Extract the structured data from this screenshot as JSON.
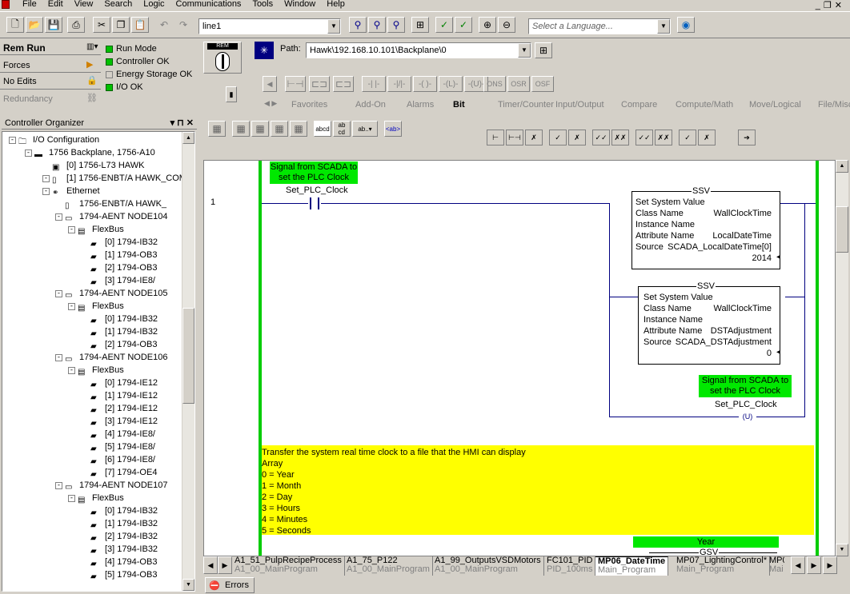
{
  "menu": [
    "File",
    "Edit",
    "View",
    "Search",
    "Logic",
    "Communications",
    "Tools",
    "Window",
    "Help"
  ],
  "toolbar": {
    "routine_combo": "line1",
    "language_placeholder": "Select a Language..."
  },
  "status": {
    "mode": "Rem Run",
    "forces": "Forces",
    "edits": "No Edits",
    "redundancy": "Redundancy",
    "run_mode": "Run Mode",
    "controller_ok": "Controller OK",
    "energy_storage": "Energy Storage OK",
    "io_ok": "I/O OK",
    "keyswitch": "REM"
  },
  "path": {
    "label": "Path:",
    "value": "Hawk\\192.168.10.101\\Backplane\\0"
  },
  "instr_bar": [
    "ONS",
    "OSR",
    "OSF"
  ],
  "instr_tabs": [
    "Favorites",
    "Add-On",
    "Alarms",
    "Bit",
    "Timer/Counter",
    "Input/Output",
    "Compare",
    "Compute/Math",
    "Move/Logical",
    "File/Misc"
  ],
  "organizer": {
    "title": "Controller Organizer",
    "pin": "▾ ⊓ ✕",
    "tree": [
      {
        "label": "I/O Configuration",
        "level": 0,
        "icon": "folder-icon"
      },
      {
        "label": "1756 Backplane, 1756-A10",
        "level": 1,
        "icon": "backplane-icon"
      },
      {
        "label": "[0] 1756-L73 HAWK",
        "level": 2,
        "icon": "controller-icon"
      },
      {
        "label": "[1] 1756-ENBT/A HAWK_COM",
        "level": 2,
        "icon": "module-icon"
      },
      {
        "label": "Ethernet",
        "level": 3,
        "icon": "network-icon"
      },
      {
        "label": "1756-ENBT/A HAWK_",
        "level": 4,
        "icon": "module-icon"
      },
      {
        "label": "1794-AENT NODE104",
        "level": 4,
        "icon": "adapter-icon"
      },
      {
        "label": "FlexBus",
        "level": 5,
        "icon": "bus-icon"
      },
      {
        "label": "[0] 1794-IB32",
        "level": 6,
        "icon": "io-module-icon"
      },
      {
        "label": "[1] 1794-OB3",
        "level": 6,
        "icon": "io-module-icon"
      },
      {
        "label": "[2] 1794-OB3",
        "level": 6,
        "icon": "io-module-icon"
      },
      {
        "label": "[3] 1794-IE8/",
        "level": 6,
        "icon": "io-module-icon"
      },
      {
        "label": "1794-AENT NODE105",
        "level": 4,
        "icon": "adapter-icon"
      },
      {
        "label": "FlexBus",
        "level": 5,
        "icon": "bus-icon"
      },
      {
        "label": "[0] 1794-IB32",
        "level": 6,
        "icon": "io-module-icon"
      },
      {
        "label": "[1] 1794-IB32",
        "level": 6,
        "icon": "io-module-icon"
      },
      {
        "label": "[2] 1794-OB3",
        "level": 6,
        "icon": "io-module-icon"
      },
      {
        "label": "1794-AENT NODE106",
        "level": 4,
        "icon": "adapter-icon"
      },
      {
        "label": "FlexBus",
        "level": 5,
        "icon": "bus-icon"
      },
      {
        "label": "[0] 1794-IE12",
        "level": 6,
        "icon": "io-module-icon"
      },
      {
        "label": "[1] 1794-IE12",
        "level": 6,
        "icon": "io-module-icon"
      },
      {
        "label": "[2] 1794-IE12",
        "level": 6,
        "icon": "io-module-icon"
      },
      {
        "label": "[3] 1794-IE12",
        "level": 6,
        "icon": "io-module-icon"
      },
      {
        "label": "[4] 1794-IE8/",
        "level": 6,
        "icon": "io-module-icon"
      },
      {
        "label": "[5] 1794-IE8/",
        "level": 6,
        "icon": "io-module-icon"
      },
      {
        "label": "[6] 1794-IE8/",
        "level": 6,
        "icon": "io-module-icon"
      },
      {
        "label": "[7] 1794-OE4",
        "level": 6,
        "icon": "io-module-icon"
      },
      {
        "label": "1794-AENT NODE107",
        "level": 4,
        "icon": "adapter-icon"
      },
      {
        "label": "FlexBus",
        "level": 5,
        "icon": "bus-icon"
      },
      {
        "label": "[0] 1794-IB32",
        "level": 6,
        "icon": "io-module-icon"
      },
      {
        "label": "[1] 1794-IB32",
        "level": 6,
        "icon": "io-module-icon"
      },
      {
        "label": "[2] 1794-IB32",
        "level": 6,
        "icon": "io-module-icon"
      },
      {
        "label": "[3] 1794-IB32",
        "level": 6,
        "icon": "io-module-icon"
      },
      {
        "label": "[4] 1794-OB3",
        "level": 6,
        "icon": "io-module-icon"
      },
      {
        "label": "[5] 1794-OB3",
        "level": 6,
        "icon": "io-module-icon"
      }
    ]
  },
  "ladder": {
    "rung_number": "1",
    "comment1_line1": "Signal from SCADA to",
    "comment1_line2": "set the PLC Clock",
    "xic_tag": "Set_PLC_Clock",
    "ssv1": {
      "name": "SSV",
      "title": "Set System Value",
      "class_label": "Class Name",
      "class_value": "WallClockTime",
      "instance_label": "Instance Name",
      "attr_label": "Attribute Name",
      "attr_value": "LocalDateTime",
      "source_label": "Source",
      "source_value": "SCADA_LocalDateTime[0]",
      "source_data": "2014"
    },
    "ssv2": {
      "name": "SSV",
      "title": "Set System Value",
      "class_label": "Class Name",
      "class_value": "WallClockTime",
      "instance_label": "Instance Name",
      "attr_label": "Attribute Name",
      "attr_value": "DSTAdjustment",
      "source_label": "Source",
      "source_value": "SCADA_DSTAdjustment",
      "source_data": "0"
    },
    "comment2_line1": "Signal from SCADA to",
    "comment2_line2": "set the PLC Clock",
    "otu_tag": "Set_PLC_Clock",
    "otu_symbol": "U",
    "rung2_comment": [
      "Transfer the system real time clock to a file that the HMI can display",
      "Array",
      "0 = Year",
      "1 = Month",
      "2 = Day",
      "3 = Hours",
      "4 = Minutes",
      "5 = Seconds"
    ],
    "year_label": "Year",
    "gsv_partial": "GSV"
  },
  "bottom_tabs": [
    {
      "title": "A1_51_PulpRecipeProcess",
      "sub": "A1_00_MainProgram",
      "active": false
    },
    {
      "title": "A1_75_P122",
      "sub": "A1_00_MainProgram",
      "active": false
    },
    {
      "title": "A1_99_OutputsVSDMotors",
      "sub": "A1_00_MainProgram",
      "active": false
    },
    {
      "title": "FC101_PID",
      "sub": "PID_100ms",
      "active": false
    },
    {
      "title": "MP06_DateTime",
      "sub": "Main_Program",
      "active": true
    },
    {
      "title": "MP07_LightingControl*",
      "sub": "Main_Program",
      "active": false
    },
    {
      "title": "MP0",
      "sub": "Mai",
      "active": false
    }
  ],
  "errors_tab": "Errors",
  "colors": {
    "rail": "#00cc00",
    "comment_green": "#00e800",
    "comment_yellow": "#ffff00",
    "rung": "#000080"
  }
}
